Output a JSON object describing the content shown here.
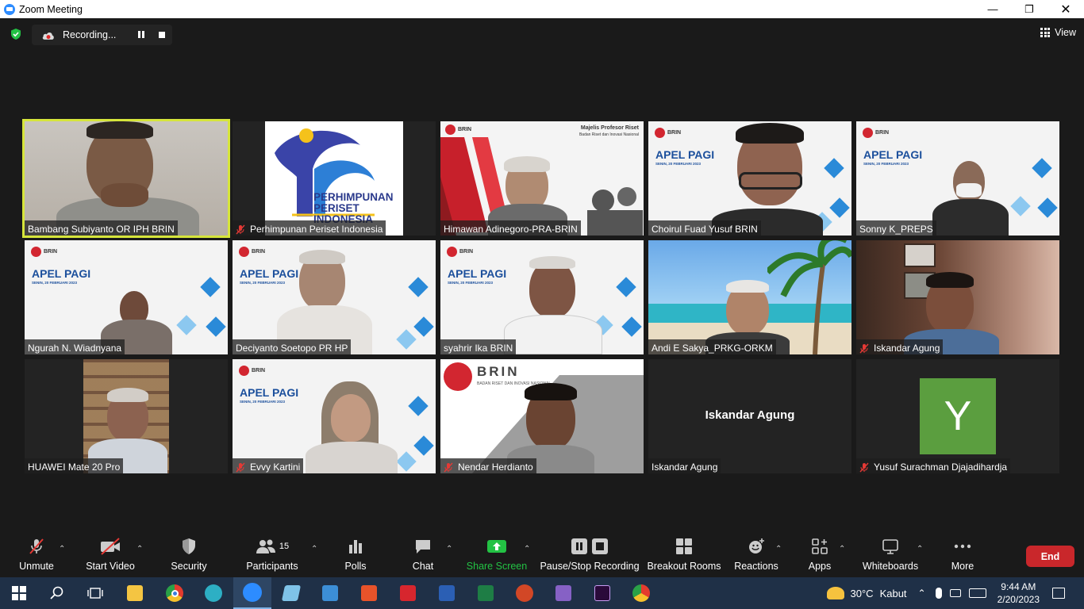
{
  "window": {
    "title": "Zoom Meeting"
  },
  "recording": {
    "label": "Recording..."
  },
  "view": {
    "label": "View"
  },
  "tiles": [
    {
      "name": "Bambang Subiyanto OR IPH BRIN",
      "muted": false
    },
    {
      "name": "Perhimpunan Periset Indonesia",
      "muted": true
    },
    {
      "name": "Himawan Adinegoro-PRA-BRIN",
      "muted": false
    },
    {
      "name": "Choirul Fuad Yusuf BRIN",
      "muted": false
    },
    {
      "name": "Sonny K_PREPS",
      "muted": false
    },
    {
      "name": "Ngurah N. Wiadnyana",
      "muted": false
    },
    {
      "name": "Deciyanto Soetopo PR HP",
      "muted": false
    },
    {
      "name": "syahrir Ika BRIN",
      "muted": false
    },
    {
      "name": "Andi E Sakya_PRKG-ORKM",
      "muted": false
    },
    {
      "name": "Iskandar Agung",
      "muted": true
    },
    {
      "name": "HUAWEI Mate 20 Pro",
      "muted": false
    },
    {
      "name": "Evvy Kartini",
      "muted": true
    },
    {
      "name": "Nendar Herdianto",
      "muted": true
    },
    {
      "name": "Iskandar Agung",
      "muted": false
    },
    {
      "name": "Yusuf Surachman Djajadihardja",
      "muted": true
    }
  ],
  "tile_content": {
    "perhimpunan_lines": [
      "PERHIMPUNAN",
      "PERISET",
      "INDONESIA"
    ],
    "majelis_title": "Majelis Profesor Riset",
    "majelis_sub": "Badan Riset dan Inovasi Nasional",
    "brin_word": "BRIN",
    "brin_sub": "BADAN RISET DAN INOVASI NASIONAL",
    "apel_title": "APEL PAGI",
    "apel_date": "SENIN, 20 FEBRUARI 2023",
    "iskandar_big": "Iskandar Agung",
    "avatar_letter": "Y"
  },
  "toolbar": {
    "unmute": "Unmute",
    "start_video": "Start Video",
    "security": "Security",
    "participants": "Participants",
    "participants_count": "15",
    "polls": "Polls",
    "chat": "Chat",
    "share_screen": "Share Screen",
    "pause_stop": "Pause/Stop Recording",
    "breakout": "Breakout Rooms",
    "reactions": "Reactions",
    "apps": "Apps",
    "whiteboards": "Whiteboards",
    "more": "More",
    "end": "End"
  },
  "taskbar": {
    "weather_temp": "30°C",
    "weather_desc": "Kabut",
    "time": "9:44 AM",
    "date": "2/20/2023"
  },
  "colors": {
    "active_speaker_border": "#d6e53b",
    "share_green": "#23c244",
    "end_red": "#c9272b",
    "avatar_green": "#5b9e3f"
  }
}
